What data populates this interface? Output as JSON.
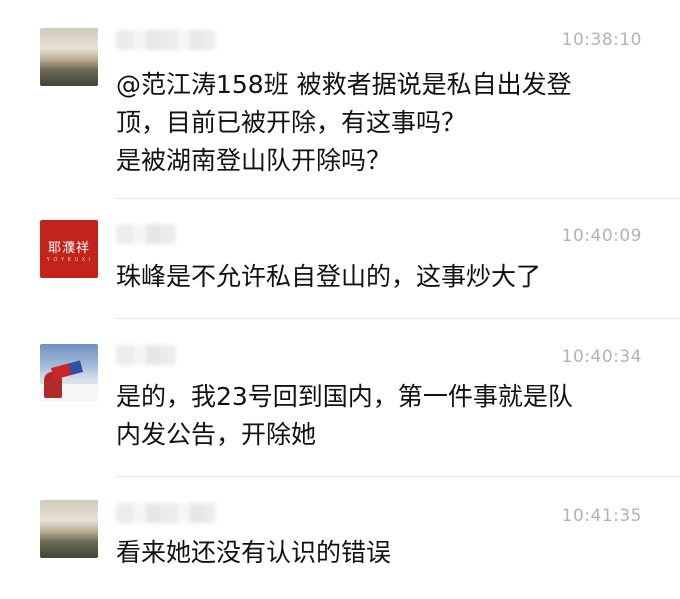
{
  "messages": [
    {
      "avatar": "landscape-avatar",
      "time": "10:38:10",
      "lines": [
        "@范江涛158班 被救者据说是私自出发登",
        "顶，目前已被开除，有这事吗？",
        "是被湖南登山队开除吗？"
      ]
    },
    {
      "avatar": "red-seal-avatar",
      "avatar_text": "耶濮祥",
      "avatar_subtext": "Y O Y K U X I",
      "time": "10:40:09",
      "lines": [
        "珠峰是不允许私自登山的，这事炒大了"
      ]
    },
    {
      "avatar": "mountain-flag-avatar",
      "time": "10:40:34",
      "lines": [
        "是的，我23号回到国内，第一件事就是队",
        "内发公告，开除她"
      ]
    },
    {
      "avatar": "landscape-avatar",
      "time": "10:41:35",
      "lines": [
        "看来她还没有认识的错误"
      ]
    }
  ],
  "colors": {
    "background": "#ffffff",
    "time_text": "#b3b3b3",
    "message_text": "#111111",
    "divider": "#e8e8e8",
    "seal_red": "#c2241c"
  }
}
